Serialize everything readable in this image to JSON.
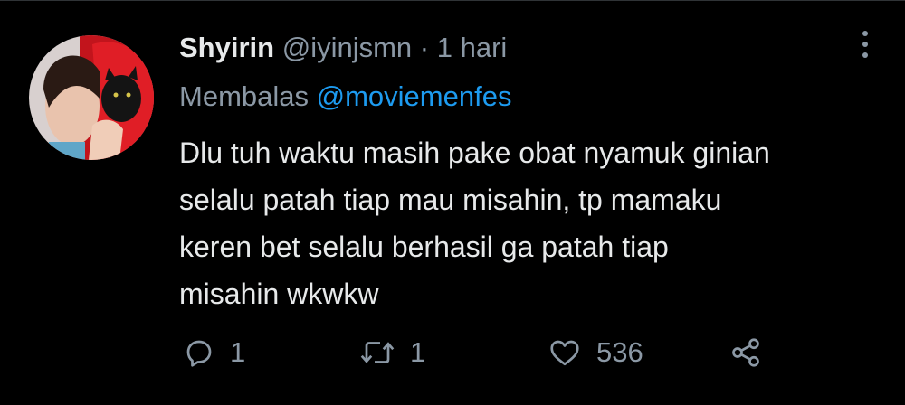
{
  "tweet": {
    "author_name": "Shyirin",
    "author_handle": "@iyinjsmn",
    "separator": "·",
    "time": "1 hari",
    "reply_prefix": "Membalas",
    "reply_to": "@moviemenfes",
    "body_lines": [
      "Dlu tuh waktu masih pake obat nyamuk ginian",
      "selalu patah tiap mau misahin, tp mamaku",
      "keren bet selalu berhasil ga patah tiap",
      "misahin wkwkw"
    ]
  },
  "actions": {
    "reply_count": "1",
    "retweet_count": "1",
    "like_count": "536"
  },
  "colors": {
    "background": "#000000",
    "text_primary": "#e7e9ea",
    "text_secondary": "#8b98a5",
    "link": "#1d9bf0"
  },
  "icons": {
    "more": "more-vertical-icon",
    "reply": "reply-icon",
    "retweet": "retweet-icon",
    "like": "heart-icon",
    "share": "share-icon"
  }
}
